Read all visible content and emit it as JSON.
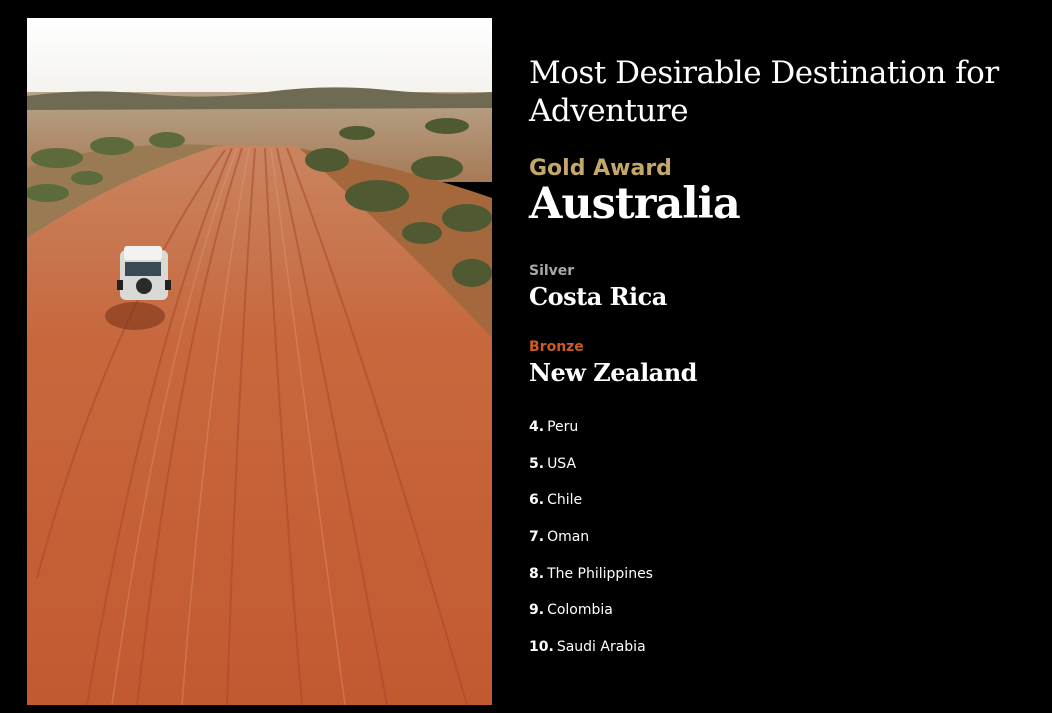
{
  "award": {
    "title": "Most Desirable Destination for Adventure",
    "gold": {
      "label": "Gold Award",
      "name": "Australia"
    },
    "silver": {
      "label": "Silver",
      "name": "Costa Rica"
    },
    "bronze": {
      "label": "Bronze",
      "name": "New Zealand"
    },
    "rankings": [
      {
        "rank": "4.",
        "name": "Peru"
      },
      {
        "rank": "5.",
        "name": "USA"
      },
      {
        "rank": "6.",
        "name": "Chile"
      },
      {
        "rank": "7.",
        "name": "Oman"
      },
      {
        "rank": "8.",
        "name": "The Philippines"
      },
      {
        "rank": "9.",
        "name": "Colombia"
      },
      {
        "rank": "10.",
        "name": "Saudi Arabia"
      }
    ]
  },
  "colors": {
    "background": "#000000",
    "text": "#ffffff",
    "gold": "#c4a86a",
    "silver": "#a9a9a9",
    "bronze": "#cf5a22"
  }
}
